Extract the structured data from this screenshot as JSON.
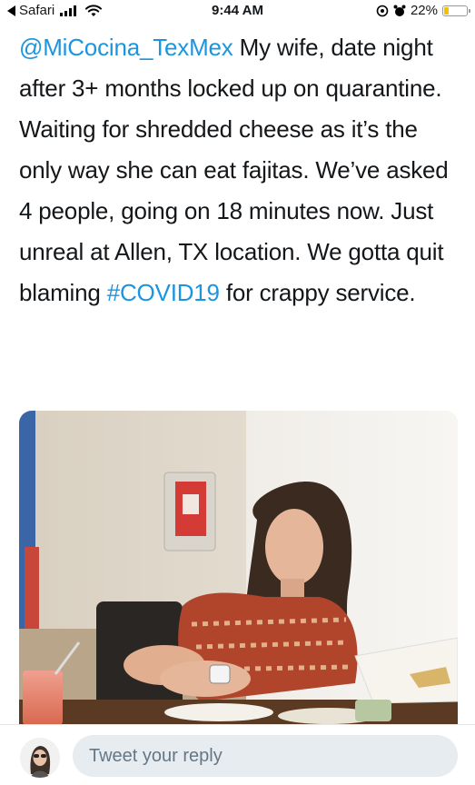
{
  "status_bar": {
    "back_app": "Safari",
    "time": "9:44 AM",
    "battery_text": "22%",
    "battery_level": 0.22,
    "icons": [
      "back-arrow-icon",
      "signal-icon",
      "wifi-icon",
      "location-icon",
      "alarm-icon",
      "battery-icon"
    ]
  },
  "tweet": {
    "mention": "@MiCocina_TexMex",
    "text_part1": " My wife, date night after 3+ months locked up on quarantine. Waiting for shredded cheese as it’s the only way she can eat fajitas. We’ve asked 4 people, going on 18 minutes now. Just unreal at Allen, TX location. We gotta quit blaming ",
    "hashtag": "#COVID19",
    "text_part2": " for crappy service."
  },
  "photo": {
    "icon": "photo-image"
  },
  "reply": {
    "placeholder": "Tweet your reply"
  },
  "colors": {
    "link": "#1b95e0",
    "reply_bg": "#e6ecf0",
    "battery": "#f2c200"
  }
}
